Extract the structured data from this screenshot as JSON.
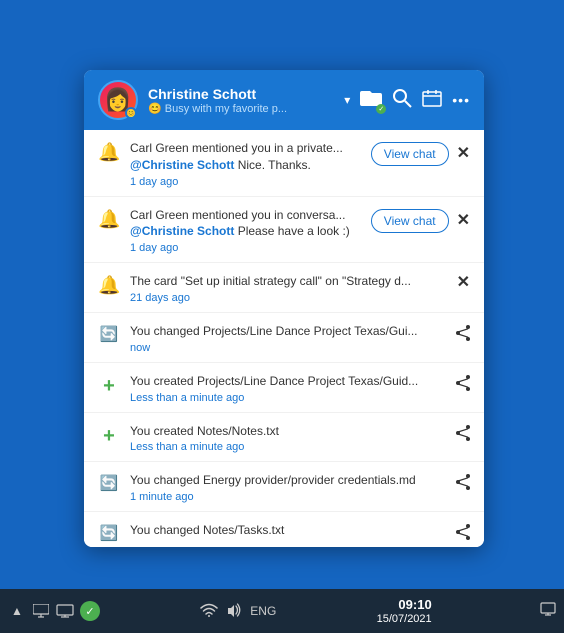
{
  "header": {
    "user_name": "Christine Schott",
    "user_status": "😊 Busy with my favorite p...",
    "avatar_emoji": "👩",
    "status_emoji": "😊"
  },
  "notifications": [
    {
      "id": 1,
      "icon_type": "bell",
      "icon_symbol": "🔔",
      "text": "Carl Green mentioned you in a private...",
      "mention": "@Christine Schott Nice. Thanks.",
      "time": "1 day ago",
      "has_view_chat": true,
      "has_close": true,
      "view_chat_label": "View chat"
    },
    {
      "id": 2,
      "icon_type": "bell",
      "icon_symbol": "🔔",
      "text": "Carl Green mentioned you in conversa...",
      "mention": "@Christine Schott Please have a look :)",
      "time": "1 day ago",
      "has_view_chat": true,
      "has_close": true,
      "view_chat_label": "View chat"
    },
    {
      "id": 3,
      "icon_type": "bell",
      "icon_symbol": "🔔",
      "text": "The card \"Set up initial strategy call\" on \"Strategy d...",
      "mention": "",
      "time": "21 days ago",
      "has_view_chat": false,
      "has_close": true,
      "view_chat_label": ""
    },
    {
      "id": 4,
      "icon_type": "sync",
      "icon_symbol": "🔄",
      "text": "You changed Projects/Line Dance Project Texas/Gui...",
      "mention": "",
      "time": "now",
      "has_view_chat": false,
      "has_close": false,
      "has_share": true
    },
    {
      "id": 5,
      "icon_type": "plus",
      "icon_symbol": "+",
      "text": "You created Projects/Line Dance Project Texas/Guid...",
      "mention": "",
      "time": "Less than a minute ago",
      "has_view_chat": false,
      "has_close": false,
      "has_share": true
    },
    {
      "id": 6,
      "icon_type": "plus",
      "icon_symbol": "+",
      "text": "You created Notes/Notes.txt",
      "mention": "",
      "time": "Less than a minute ago",
      "has_view_chat": false,
      "has_close": false,
      "has_share": true
    },
    {
      "id": 7,
      "icon_type": "sync",
      "icon_symbol": "🔄",
      "text": "You changed Energy provider/provider credentials.md",
      "mention": "",
      "time": "1 minute ago",
      "has_view_chat": false,
      "has_close": false,
      "has_share": true
    },
    {
      "id": 8,
      "icon_type": "sync",
      "icon_symbol": "🔄",
      "text": "You changed Notes/Tasks.txt",
      "mention": "",
      "time": "",
      "has_view_chat": false,
      "has_close": false,
      "has_share": true
    }
  ],
  "taskbar": {
    "time": "09:10",
    "date": "15/07/2021",
    "lang": "ENG"
  }
}
